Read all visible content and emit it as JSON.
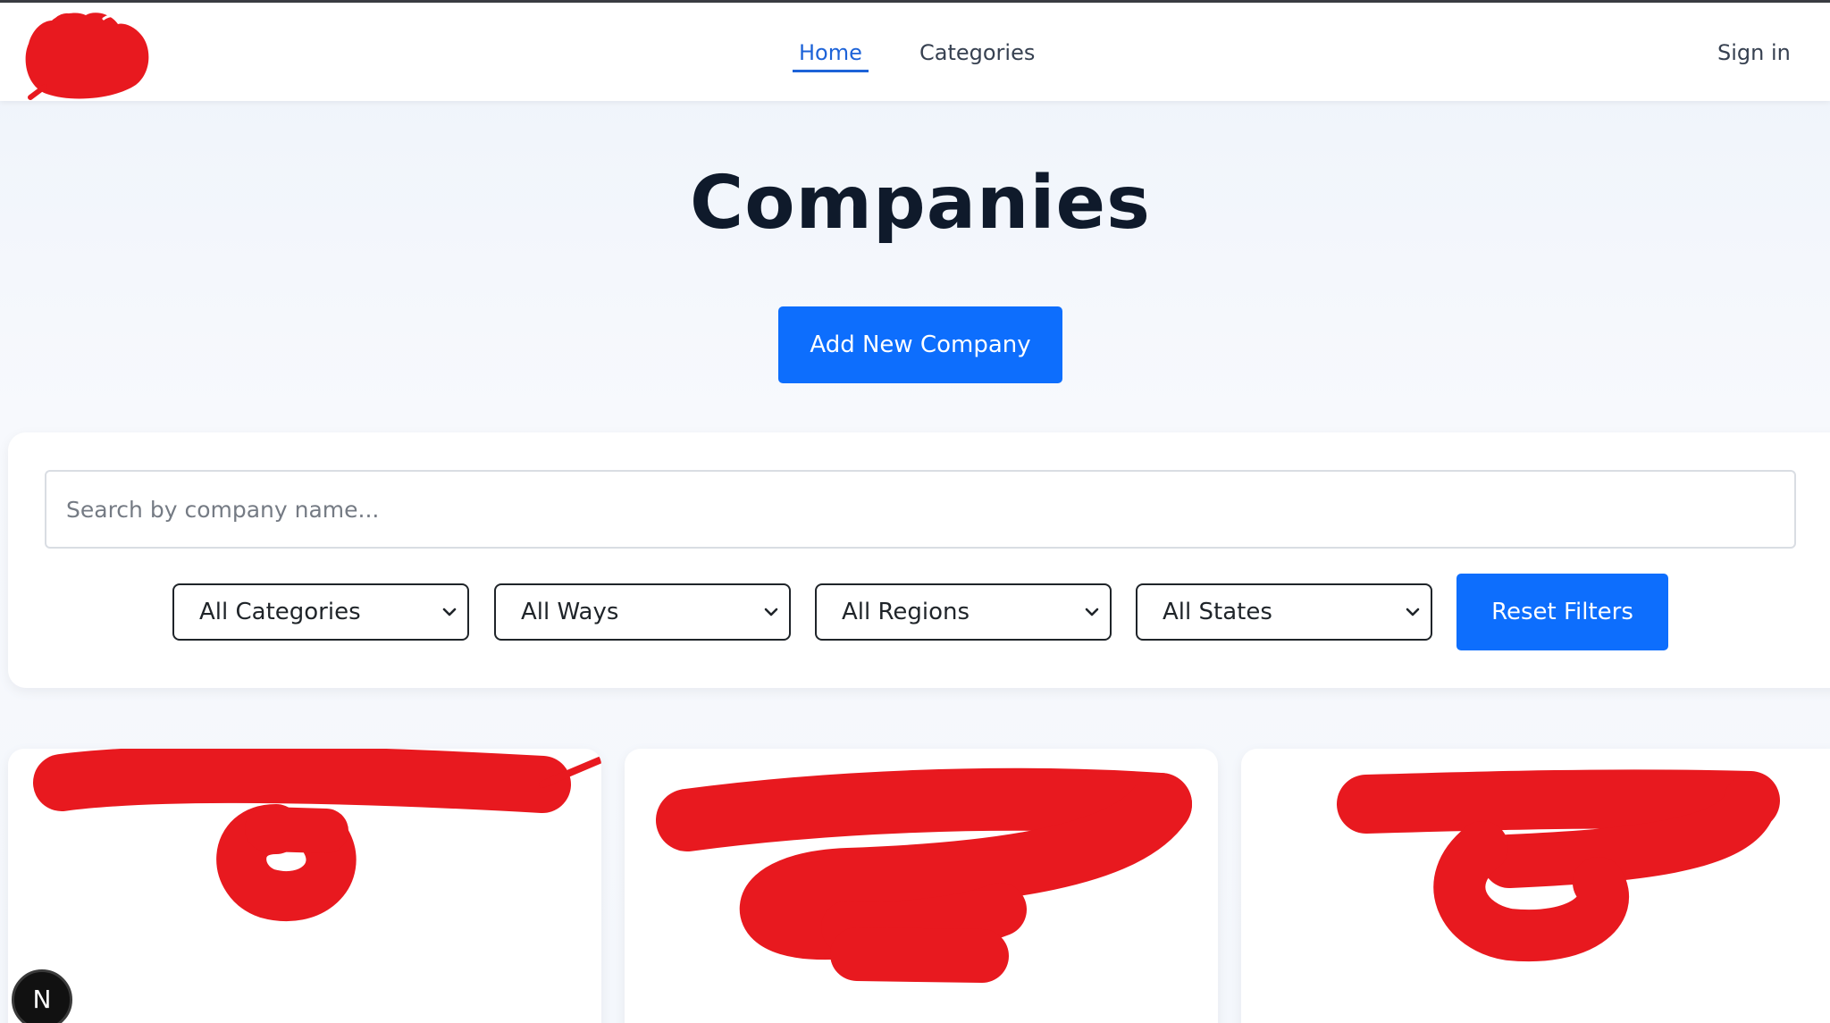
{
  "nav": {
    "home": "Home",
    "categories": "Categories",
    "sign_in": "Sign in"
  },
  "hero": {
    "title": "Companies",
    "add_button": "Add New Company"
  },
  "filters": {
    "search_placeholder": "Search by company name...",
    "category": "All Categories",
    "ways": "All Ways",
    "regions": "All Regions",
    "states": "All States",
    "reset_button": "Reset Filters"
  },
  "colors": {
    "primary": "#0d6efd",
    "nav_active": "#1d63d8",
    "redaction": "#e8191f"
  },
  "dev_badge": {
    "label": "N"
  }
}
